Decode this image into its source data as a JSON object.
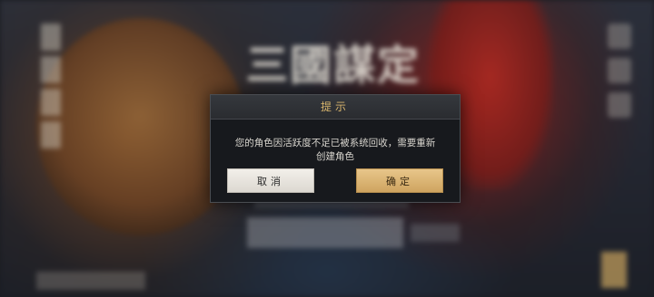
{
  "background": {
    "logo_text": "三國謀定"
  },
  "dialog": {
    "title": "提示",
    "message_line1": "您的角色因活跃度不足已被系统回收，需要重新",
    "message_line2": "创建角色",
    "cancel_label": "取消",
    "confirm_label": "确定"
  },
  "colors": {
    "title": "#d8b56c",
    "confirm_button": "#dcb474",
    "cancel_button": "#e8e5e0",
    "dialog_bg": "#17191d"
  }
}
